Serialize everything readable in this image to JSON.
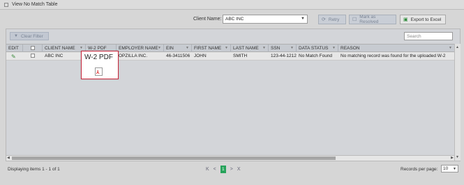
{
  "window": {
    "title": "View No Match Table"
  },
  "toolbar": {
    "client_label": "Client Name:",
    "client_value": "ABC INC",
    "retry_label": "Retry",
    "mark_resolved_label": "Mark as Resolved",
    "export_label": "Export to Excel"
  },
  "grid": {
    "clear_filter_label": "Clear Filter",
    "search_placeholder": "Search",
    "columns": [
      "EDIT",
      "CLIENT NAME",
      "W-2 PDF",
      "EMPLOYER NAME",
      "EIN",
      "FIRST NAME",
      "LAST NAME",
      "SSN",
      "DATA STATUS",
      "REASON"
    ],
    "rows": [
      {
        "client_name": "ABC INC",
        "employer_name": "OPZILLA INC.",
        "ein": "46-3411506",
        "first_name": "JOHN",
        "last_name": "SMITH",
        "ssn": "123-44-1212",
        "data_status": "No Match Found",
        "reason": "No matching record was found for the uploaded W-2"
      }
    ]
  },
  "popup": {
    "title": "W-2 PDF",
    "icon": "pdf-file-icon"
  },
  "footer": {
    "info": "Displaying items 1 - 1 of 1",
    "current_page": "1",
    "rpp_label": "Records per page:",
    "rpp_value": "10"
  },
  "colors": {
    "accent_green": "#27a35b",
    "popup_border": "#c8253a"
  }
}
